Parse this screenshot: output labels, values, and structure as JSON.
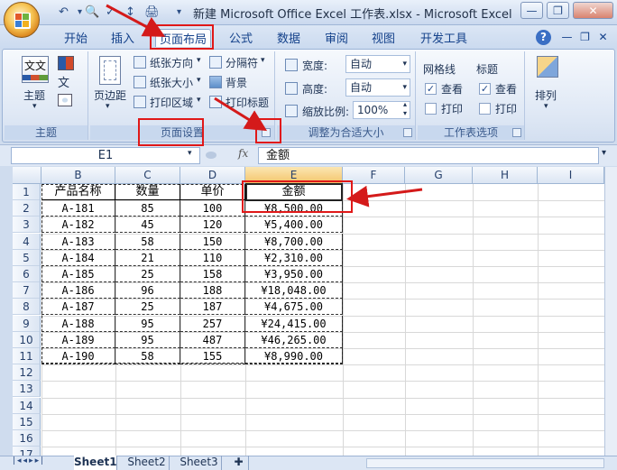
{
  "window": {
    "title": "新建 Microsoft Office Excel 工作表.xlsx - Microsoft Excel",
    "minimize": "—",
    "restore": "❐",
    "close": "✕"
  },
  "quick_access": {
    "undo": "↶",
    "redo": "↷",
    "print": "🖨"
  },
  "tabs": [
    "开始",
    "插入",
    "页面布局",
    "公式",
    "数据",
    "审阅",
    "视图",
    "开发工具"
  ],
  "ribbon": {
    "themes": {
      "label": "主题",
      "group": "主题"
    },
    "page_setup": {
      "margins": "页边距",
      "orientation": "纸张方向",
      "size": "纸张大小",
      "print_area": "打印区域",
      "breaks": "分隔符",
      "background": "背景",
      "print_titles": "打印标题",
      "group": "页面设置"
    },
    "scale": {
      "width_label": "宽度:",
      "width_value": "自动",
      "height_label": "高度:",
      "height_value": "自动",
      "scale_label": "缩放比例:",
      "scale_value": "100%",
      "group": "调整为合适大小"
    },
    "sheet_options": {
      "gridlines": "网格线",
      "headings": "标题",
      "view": "查看",
      "print": "打印",
      "group": "工作表选项"
    },
    "arrange": {
      "label": "排列"
    }
  },
  "formula_bar": {
    "name_box": "E1",
    "fx": "fx",
    "formula": "金额"
  },
  "columns": [
    "B",
    "C",
    "D",
    "E",
    "F",
    "G",
    "H",
    "I"
  ],
  "rows": [
    "1",
    "2",
    "3",
    "4",
    "5",
    "6",
    "7",
    "8",
    "9",
    "10",
    "11",
    "12",
    "13",
    "14",
    "15",
    "16",
    "17"
  ],
  "table": {
    "headers": [
      "产品名称",
      "数量",
      "单价",
      "金额"
    ],
    "rows": [
      [
        "A-181",
        "85",
        "100",
        "¥8,500.00"
      ],
      [
        "A-182",
        "45",
        "120",
        "¥5,400.00"
      ],
      [
        "A-183",
        "58",
        "150",
        "¥8,700.00"
      ],
      [
        "A-184",
        "21",
        "110",
        "¥2,310.00"
      ],
      [
        "A-185",
        "25",
        "158",
        "¥3,950.00"
      ],
      [
        "A-186",
        "96",
        "188",
        "¥18,048.00"
      ],
      [
        "A-187",
        "25",
        "187",
        "¥4,675.00"
      ],
      [
        "A-188",
        "95",
        "257",
        "¥24,415.00"
      ],
      [
        "A-189",
        "95",
        "487",
        "¥46,265.00"
      ],
      [
        "A-190",
        "58",
        "155",
        "¥8,990.00"
      ]
    ]
  },
  "sheet_tabs": [
    "Sheet1",
    "Sheet2",
    "Sheet3"
  ],
  "colors": {
    "annotation": "#e01818",
    "selected_header": "#f4c56b",
    "ribbon": "#dfe8f5"
  }
}
